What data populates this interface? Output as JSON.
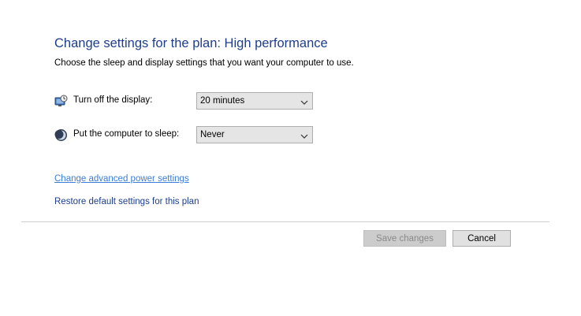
{
  "header": {
    "title": "Change settings for the plan: High performance",
    "subtitle": "Choose the sleep and display settings that you want your computer to use."
  },
  "settings": [
    {
      "label": "Turn off the display:",
      "value": "20 minutes",
      "icon": "display-power-icon"
    },
    {
      "label": "Put the computer to sleep:",
      "value": "Never",
      "icon": "sleep-moon-icon"
    }
  ],
  "links": {
    "advanced": "Change advanced power settings",
    "restore": "Restore default settings for this plan"
  },
  "buttons": {
    "save": "Save changes",
    "cancel": "Cancel"
  },
  "colors": {
    "title": "#1e3e8c",
    "link_hover": "#3b7dd8",
    "dropdown_bg": "#e5e5e5"
  }
}
